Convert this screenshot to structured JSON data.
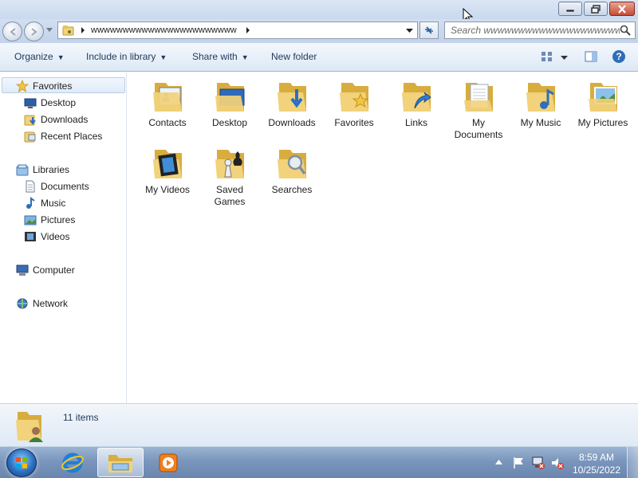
{
  "window": {
    "minimize_icon": "minimize-icon",
    "restore_icon": "restore-icon",
    "close_icon": "close-icon"
  },
  "address": {
    "path_segment": "wwwwwwwwwwwwwwwwwwwwwww",
    "search_placeholder": "Search wwwwwwwwwwwwwwwwwwwwwww..."
  },
  "toolbar": {
    "organize": "Organize",
    "include_in_library": "Include in library",
    "share_with": "Share with",
    "new_folder": "New folder"
  },
  "nav": {
    "favorites": "Favorites",
    "desktop": "Desktop",
    "downloads": "Downloads",
    "recent_places": "Recent Places",
    "libraries": "Libraries",
    "documents": "Documents",
    "music": "Music",
    "pictures": "Pictures",
    "videos": "Videos",
    "computer": "Computer",
    "network": "Network"
  },
  "items": [
    {
      "label": "Contacts",
      "icon": "contacts-folder-icon"
    },
    {
      "label": "Desktop",
      "icon": "desktop-folder-icon"
    },
    {
      "label": "Downloads",
      "icon": "downloads-folder-icon"
    },
    {
      "label": "Favorites",
      "icon": "favorites-folder-icon"
    },
    {
      "label": "Links",
      "icon": "links-folder-icon"
    },
    {
      "label": "My Documents",
      "icon": "documents-folder-icon"
    },
    {
      "label": "My Music",
      "icon": "music-folder-icon"
    },
    {
      "label": "My Pictures",
      "icon": "pictures-folder-icon"
    },
    {
      "label": "My Videos",
      "icon": "videos-folder-icon"
    },
    {
      "label": "Saved Games",
      "icon": "saved-games-folder-icon"
    },
    {
      "label": "Searches",
      "icon": "searches-folder-icon"
    }
  ],
  "details": {
    "item_count": "11 items"
  },
  "taskbar": {
    "time": "8:59 AM",
    "date": "10/25/2022"
  },
  "colors": {
    "folder": "#f2d27a",
    "folder_dark": "#d8ad3e",
    "link_text": "#1e395b"
  }
}
